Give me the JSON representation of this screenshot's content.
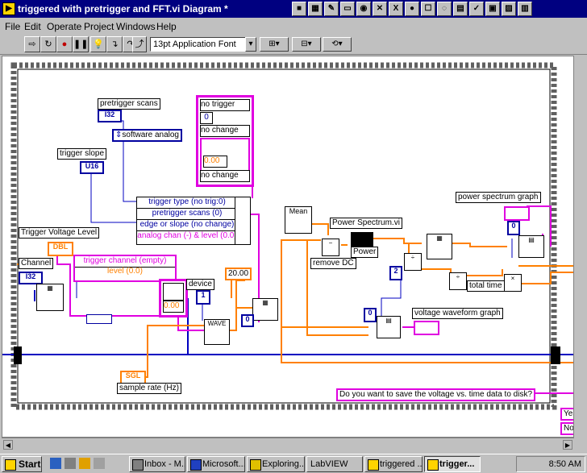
{
  "window": {
    "title": "triggered with pretrigger and FFT.vi Diagram *"
  },
  "menu": [
    "File",
    "Edit",
    "Operate",
    "Project",
    "Windows",
    "Help"
  ],
  "toolbar": {
    "font": "13pt Application Font"
  },
  "diagram": {
    "labels": {
      "pretrigger_scans": "pretrigger scans",
      "software_analog": "software analog",
      "trigger_slope": "trigger slope",
      "trigger_voltage_level": "Trigger Voltage Level",
      "channel": "Channel",
      "device": "device",
      "twenty": "20.00",
      "power_spectrum_vi": "Power Spectrum.vi",
      "power": "Power",
      "remove_dc": "remove DC",
      "mean": "Mean",
      "power_spectrum_graph": "power spectrum graph",
      "total_time": "total time",
      "voltage_waveform_graph": "voltage waveform graph",
      "sample_rate": "sample rate (Hz)",
      "save_question": "Do you want to save the voltage vs. time data to disk?",
      "yes": "Yes",
      "no": "No",
      "zero_a": "0",
      "zero_b": "0",
      "zero_c": "0",
      "zero_d": "0",
      "one": "1",
      "two": "2",
      "one_small": "1",
      "zero_point": "0.00",
      "zero_point_2": "0.00"
    },
    "terminals": {
      "i32": "I32",
      "u16": "U16",
      "dbl": "DBL",
      "sgl": "SGL",
      "i32b": "I32"
    },
    "trigger_cluster": [
      "trigger type (no trig:0)",
      "pretrigger scans (0)",
      "edge or slope (no change)",
      "analog chan (-) & level (0.0)"
    ],
    "channel_cluster": [
      "trigger channel (empty)",
      "level (0.0)"
    ],
    "menu_stack": [
      "no trigger",
      "no change",
      "no change"
    ]
  },
  "taskbar": {
    "start": "Start",
    "tasks": [
      "Inbox - M...",
      "Microsoft...",
      "Exploring...",
      "LabVIEW",
      "triggered ...",
      "trigger..."
    ],
    "clock": "8:50 AM"
  }
}
